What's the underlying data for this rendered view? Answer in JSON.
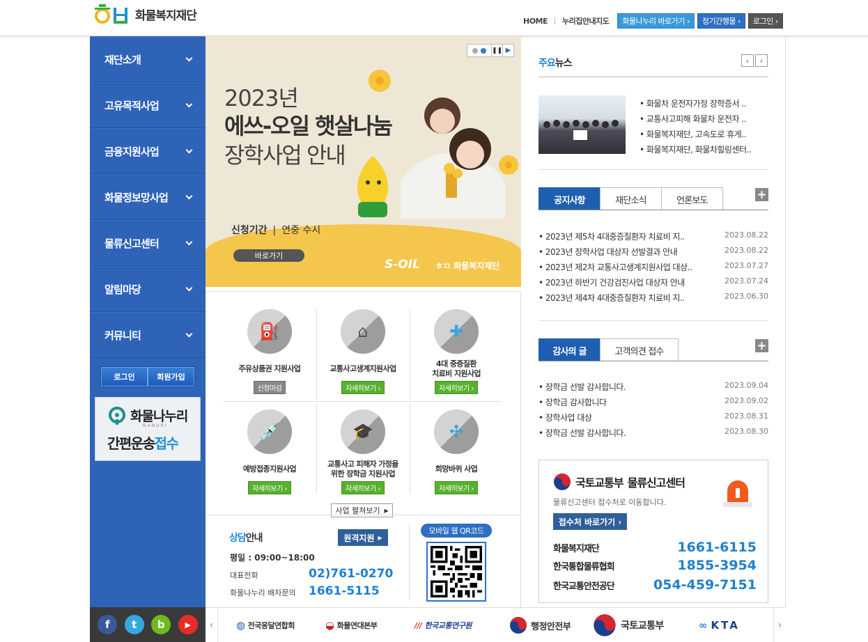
{
  "header": {
    "logo_text": "화물복지재단",
    "nav": [
      "HOME",
      "누리집안내지도"
    ],
    "buttons": [
      "화물나누리 바로가기 ›",
      "정기간행물 ›",
      "로그인 ›"
    ]
  },
  "sidebar": {
    "items": [
      {
        "label": "재단소개"
      },
      {
        "label": "고유목적사업"
      },
      {
        "label": "금융지원사업"
      },
      {
        "label": "화물정보망사업"
      },
      {
        "label": "물류신고센터"
      },
      {
        "label": "알림마당"
      },
      {
        "label": "커뮤니티"
      }
    ],
    "login": "로그인",
    "join": "회원가입",
    "nanuri_title": "화물나누리",
    "nanuri_sub": "NANURI",
    "nanuri_text1": "간편운송",
    "nanuri_text2": "접수"
  },
  "social": [
    "f",
    "t",
    "b",
    "▶"
  ],
  "banner": {
    "year": "2023년",
    "title": "에쓰-오일 햇살나눔",
    "title2": "장학사업 안내",
    "period_label": "신청기간",
    "period_value": "연중 수시",
    "button": "바로가기",
    "brand1": "S-OIL",
    "brand2": "화물복지재단"
  },
  "business": {
    "items": [
      {
        "label": "주유상품권 지원사업",
        "button": "신청마감"
      },
      {
        "label": "교통사고생계지원사업",
        "button": "자세히보기 ›"
      },
      {
        "label": "4대 중증질환\n치료비 지원사업",
        "button": "자세히보기 ›"
      },
      {
        "label": "예방접종지원사업",
        "button": "자세히보기 ›"
      },
      {
        "label": "교통사고 피해자 가정을\n위한 장학금 지원사업",
        "button": "자세히보기 ›"
      },
      {
        "label": "희망바퀴 사업",
        "button": "자세히보기 ›"
      }
    ],
    "all_button": "사업 펼쳐보기"
  },
  "consult": {
    "title_accent": "상담",
    "title_rest": "안내",
    "remote_button": "원격지원",
    "hours": "평일 : 09:00~18:00",
    "main_phone_label": "대표전화",
    "main_phone": "02)761-0270",
    "dispatch_label": "화물나누리 배차문의",
    "dispatch_phone": "1661-5115",
    "qr_label": "모바일 웹 QR코드"
  },
  "news": {
    "title_accent": "주요",
    "title_rest": "뉴스",
    "items": [
      "화물차 운전자가정 장학증서 ..",
      "교통사고피해 화물차 운전자 ..",
      "화물복지재단, 고속도로 휴게..",
      "화물복지재단, 화물차힐링센터.."
    ]
  },
  "notice": {
    "tabs": [
      "공지사항",
      "재단소식",
      "언론보도"
    ],
    "rows": [
      {
        "title": "2023년 제5차 4대중증질환자 치료비 지..",
        "date": "2023.08.22"
      },
      {
        "title": "2023년 장학사업 대상자 선발결과 안내",
        "date": "2023.08.22"
      },
      {
        "title": "2023년 제2차 교통사고생계지원사업 대상..",
        "date": "2023.07.27"
      },
      {
        "title": "2023년 하반기 건강검진사업 대상자 안내",
        "date": "2023.07.24"
      },
      {
        "title": "2023년 제4차 4대중증질환자 치료비 지..",
        "date": "2023.06.30"
      }
    ]
  },
  "thanks": {
    "tabs": [
      "감사의 글",
      "고객의견 접수"
    ],
    "rows": [
      {
        "title": "장학금 선발 감사합니다.",
        "date": "2023.09.04"
      },
      {
        "title": "장학금 감사합니다",
        "date": "2023.09.02"
      },
      {
        "title": "장학사업 대상",
        "date": "2023.08.31"
      },
      {
        "title": "장학금 선발 감사합니다.",
        "date": "2023.08.30"
      }
    ]
  },
  "report": {
    "ministry": "국토교통부",
    "center": "물류신고센터",
    "sub": "물류신고센터 접수처로 이동합니다.",
    "button": "접수처 바로가기 ›",
    "rows": [
      {
        "name": "화물복지재단",
        "phone": "1661-6115"
      },
      {
        "name": "한국통합물류협회",
        "phone": "1855-3954"
      },
      {
        "name": "한국교통안전공단",
        "phone": "054-459-7151"
      }
    ]
  },
  "partners": [
    "전국응달연합회",
    "화물연대본부",
    "한국교통연구원",
    "행정안전부",
    "국토교통부",
    "KTA"
  ],
  "colors": {
    "primary": "#2e63b8",
    "accent": "#1f7fd0",
    "banner_yellow": "#f4c64c"
  }
}
